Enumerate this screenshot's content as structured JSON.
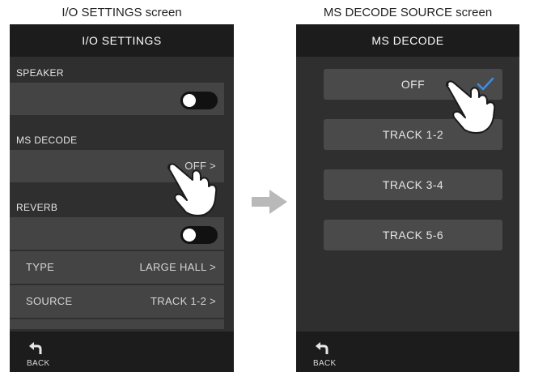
{
  "captions": {
    "left": "I/O SETTINGS screen",
    "right": "MS DECODE SOURCE screen"
  },
  "left_screen": {
    "title": "I/O SETTINGS",
    "speaker": {
      "label": "SPEAKER",
      "toggle_on": false
    },
    "ms_decode": {
      "label": "MS DECODE",
      "value": "OFF >"
    },
    "reverb": {
      "label": "REVERB",
      "toggle_on": false,
      "type": {
        "label": "TYPE",
        "value": "LARGE HALL >"
      },
      "source": {
        "label": "SOURCE",
        "value": "TRACK 1-2 >"
      }
    },
    "back_label": "BACK"
  },
  "right_screen": {
    "title": "MS DECODE",
    "options": [
      "OFF",
      "TRACK 1-2",
      "TRACK 3-4",
      "TRACK 5-6"
    ],
    "selected": "OFF",
    "back_label": "BACK"
  },
  "colors": {
    "check": "#3a8ee6",
    "screen_bg": "#2f2f2f",
    "row_bg": "#444444",
    "bar_bg": "#1c1c1c",
    "arrow": "#b9b9b9"
  },
  "icons": [
    "back-arrow-icon",
    "check-icon",
    "pointing-hand-icon",
    "right-arrow-icon",
    "toggle-icon"
  ]
}
